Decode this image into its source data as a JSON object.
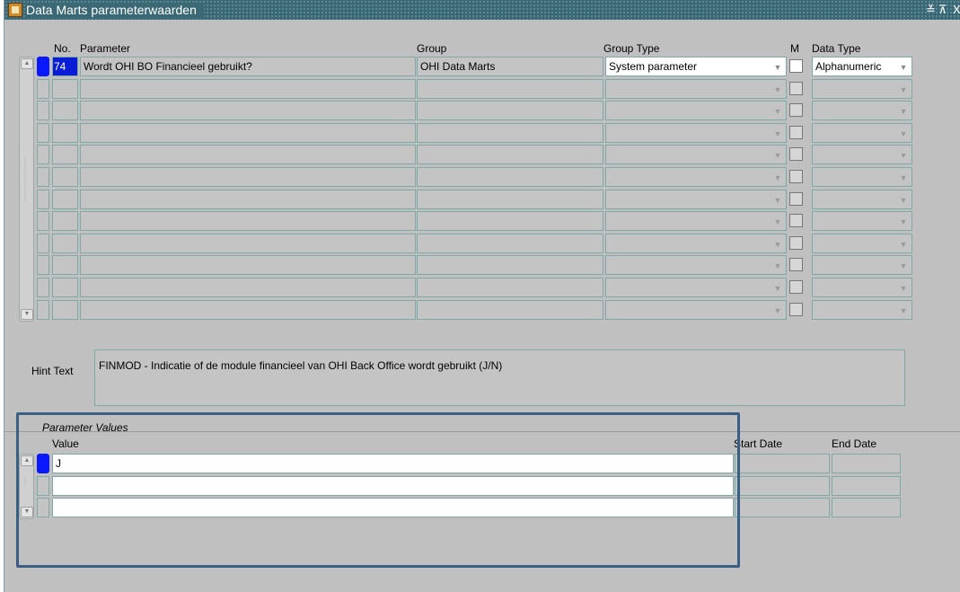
{
  "window": {
    "title": "Data Marts parameterwaarden",
    "controls": [
      "≚",
      "⊼",
      "X"
    ]
  },
  "grid": {
    "headers": {
      "no": "No.",
      "parameter": "Parameter",
      "group": "Group",
      "group_type": "Group Type",
      "m": "M",
      "data_type": "Data Type"
    },
    "rows": [
      {
        "no": "74",
        "parameter": "Wordt OHI BO Financieel gebruikt?",
        "group": "OHI Data Marts",
        "group_type": "System parameter",
        "m": false,
        "data_type": "Alphanumeric"
      },
      {
        "no": "",
        "parameter": "",
        "group": "",
        "group_type": "",
        "m": false,
        "data_type": ""
      },
      {
        "no": "",
        "parameter": "",
        "group": "",
        "group_type": "",
        "m": false,
        "data_type": ""
      },
      {
        "no": "",
        "parameter": "",
        "group": "",
        "group_type": "",
        "m": false,
        "data_type": ""
      },
      {
        "no": "",
        "parameter": "",
        "group": "",
        "group_type": "",
        "m": false,
        "data_type": ""
      },
      {
        "no": "",
        "parameter": "",
        "group": "",
        "group_type": "",
        "m": false,
        "data_type": ""
      },
      {
        "no": "",
        "parameter": "",
        "group": "",
        "group_type": "",
        "m": false,
        "data_type": ""
      },
      {
        "no": "",
        "parameter": "",
        "group": "",
        "group_type": "",
        "m": false,
        "data_type": ""
      },
      {
        "no": "",
        "parameter": "",
        "group": "",
        "group_type": "",
        "m": false,
        "data_type": ""
      },
      {
        "no": "",
        "parameter": "",
        "group": "",
        "group_type": "",
        "m": false,
        "data_type": ""
      },
      {
        "no": "",
        "parameter": "",
        "group": "",
        "group_type": "",
        "m": false,
        "data_type": ""
      },
      {
        "no": "",
        "parameter": "",
        "group": "",
        "group_type": "",
        "m": false,
        "data_type": ""
      }
    ]
  },
  "hint": {
    "label": "Hint Text",
    "text": "FINMOD - Indicatie of de module financieel van OHI Back Office wordt gebruikt (J/N)"
  },
  "param_values": {
    "section_label": "Parameter Values",
    "headers": {
      "value": "Value",
      "start_date": "Start Date",
      "end_date": "End Date"
    },
    "rows": [
      {
        "value": "J",
        "start_date": "",
        "end_date": ""
      },
      {
        "value": "",
        "start_date": "",
        "end_date": ""
      },
      {
        "value": "",
        "start_date": "",
        "end_date": ""
      }
    ]
  },
  "colors": {
    "titlebar": "#3a6874",
    "form_background": "#c0c0c0",
    "field_border": "#7fa9a7",
    "selection": "#0a18ff",
    "highlight_frame": "#3a5f85"
  },
  "icons": {
    "dropdown": "dropdown-arrow-icon",
    "scroll_up": "scroll-up-icon",
    "scroll_down": "scroll-down-icon",
    "app": "forms-app-icon"
  }
}
